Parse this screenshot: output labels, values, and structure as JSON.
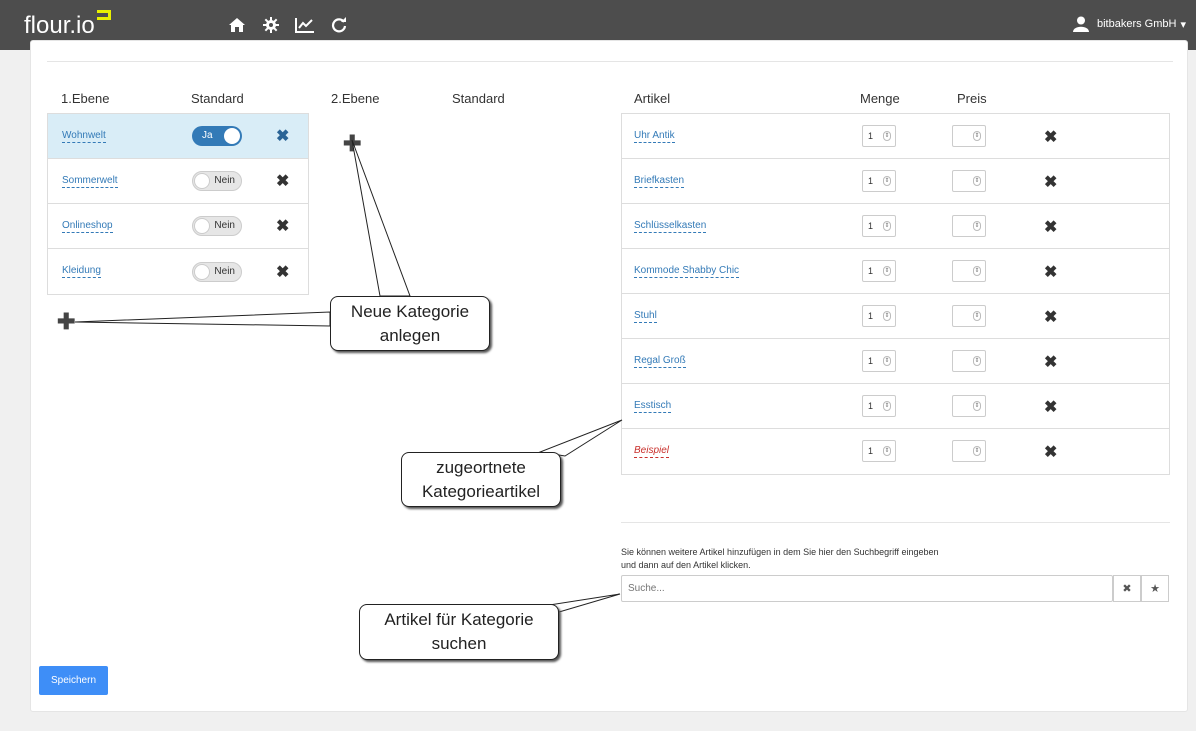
{
  "navbar": {
    "brand": "flour.io",
    "icons": [
      "home-icon",
      "gear-icon",
      "chart-icon",
      "refresh-icon"
    ],
    "user": "bitbakers GmbH",
    "user_caret": "▾"
  },
  "level1": {
    "header_label": "1.Ebene",
    "header_standard": "Standard",
    "rows": [
      {
        "name": "Wohnwelt",
        "toggle": "Ja"
      },
      {
        "name": "Sommerwelt",
        "toggle": "Nein"
      },
      {
        "name": "Onlineshop",
        "toggle": "Nein"
      },
      {
        "name": "Kleidung",
        "toggle": "Nein"
      }
    ]
  },
  "level2": {
    "header_label": "2.Ebene",
    "header_standard": "Standard"
  },
  "articles": {
    "header_article": "Artikel",
    "header_qty": "Menge",
    "header_price": "Preis",
    "rows": [
      {
        "name": "Uhr Antik",
        "qty": "1"
      },
      {
        "name": "Briefkasten",
        "qty": "1"
      },
      {
        "name": "Schlüsselkasten",
        "qty": "1"
      },
      {
        "name": "Kommode Shabby Chic",
        "qty": "1"
      },
      {
        "name": "Stuhl",
        "qty": "1"
      },
      {
        "name": "Regal Groß",
        "qty": "1"
      },
      {
        "name": "Esstisch",
        "qty": "1"
      },
      {
        "name": "Beispiel",
        "qty": "1"
      }
    ]
  },
  "search": {
    "help_line1": "Sie können weitere Artikel hinzufügen in dem Sie hier den Suchbegriff eingeben",
    "help_line2": "und dann auf den Artikel klicken.",
    "placeholder": "Suche..."
  },
  "save_label": "Speichern",
  "callouts": {
    "new_category": [
      "Neue Kategorie",
      "anlegen"
    ],
    "assigned_articles": [
      "zugeortnete",
      "Kategorieartikel"
    ],
    "search_articles": [
      "Artikel für Kategorie",
      "suchen"
    ]
  },
  "colors": {
    "navbar": "#4d4d4d",
    "brand_accent": "#e8f000",
    "link": "#337ab7",
    "selected_row": "#d9edf7",
    "save_button": "#3e8ef7",
    "highlight_article": "#c9302c"
  }
}
